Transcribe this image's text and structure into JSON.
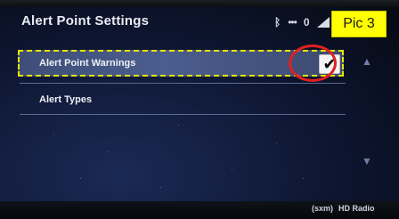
{
  "header": {
    "title": "Alert Point Settings",
    "status": {
      "bluetooth": "ᛒ",
      "dots": "•••",
      "zero": "0"
    }
  },
  "annotation": {
    "pic_label": "Pic 3"
  },
  "list": {
    "items": [
      {
        "label": "Alert Point Warnings",
        "checked": true,
        "check_glyph": "✔"
      },
      {
        "label": "Alert Types"
      }
    ]
  },
  "footer": {
    "brand1": "(sxm)",
    "brand2": "HD Radio"
  },
  "colors": {
    "highlight_box": "#e6e600",
    "callout_ring": "#e02020",
    "pic_badge_bg": "#ffff00"
  },
  "icons": [
    "bluetooth-icon",
    "signal-icon",
    "battery-icon",
    "scroll-up-icon",
    "scroll-down-icon"
  ]
}
